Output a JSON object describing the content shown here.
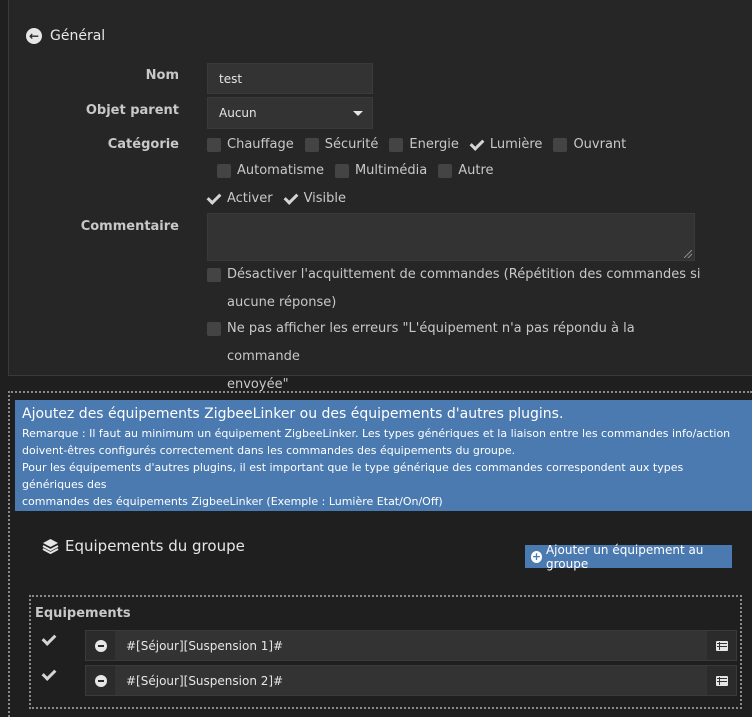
{
  "general": {
    "title": "Général",
    "name_label": "Nom",
    "name_value": "test",
    "parent_label": "Objet parent",
    "parent_value": "Aucun",
    "category_label": "Catégorie",
    "categories": [
      {
        "label": "Chauffage",
        "checked": false
      },
      {
        "label": "Sécurité",
        "checked": false
      },
      {
        "label": "Energie",
        "checked": false
      },
      {
        "label": "Lumière",
        "checked": true
      },
      {
        "label": "Ouvrant",
        "checked": false
      },
      {
        "label": "Automatisme",
        "checked": false
      },
      {
        "label": "Multimédia",
        "checked": false
      },
      {
        "label": "Autre",
        "checked": false
      }
    ],
    "activate_label": "Activer",
    "visible_label": "Visible",
    "comment_label": "Commentaire",
    "option1_line1": "Désactiver l'acquittement de commandes (Répétition des commandes si",
    "option1_line2": "aucune réponse)",
    "option2_line1": "Ne pas afficher les erreurs \"L'équipement n'a pas répondu à la commande",
    "option2_line2": "envoyée\""
  },
  "info": {
    "heading": "Ajoutez des équipements ZigbeeLinker ou des équipements d'autres plugins.",
    "line1": "Remarque : Il faut au minimum un équipement ZigbeeLinker. Les types génériques et la liaison entre les commandes info/action",
    "line2": "doivent-êtres configurés correctement dans les commandes des équipements du groupe.",
    "line3": "Pour les équipements d'autres plugins, il est important que le type générique des commandes correspondent aux types génériques des",
    "line4": "commandes des équipements ZigbeeLinker (Exemple : Lumière Etat/On/Off)"
  },
  "group": {
    "title": "Equipements du groupe",
    "add_button": "Ajouter un équipement au groupe",
    "list_title": "Equipements",
    "rows": [
      {
        "value": "#[Séjour][Suspension 1]#",
        "checked": true
      },
      {
        "value": "#[Séjour][Suspension 2]#",
        "checked": true
      }
    ]
  }
}
